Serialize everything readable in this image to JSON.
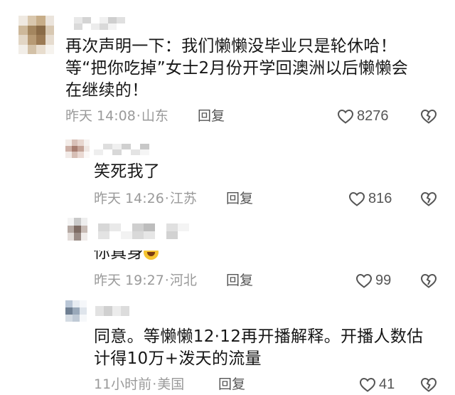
{
  "comments": [
    {
      "text_lines": [
        "再次声明一下：我们懒懒没毕业只是轮休哈！",
        "等“把你吃掉”女士2月份开学回澳洲以后懒懒会",
        "在继续的！"
      ],
      "time": "昨天 14:08",
      "location": "山东",
      "reply_label": "回复",
      "likes": "8276"
    },
    {
      "text_lines": [
        "笑死我了"
      ],
      "time": "昨天 14:26",
      "location": "江苏",
      "reply_label": "回复",
      "likes": "816"
    },
    {
      "text_lines": [
        "你真身"
      ],
      "time": "昨天 19:27",
      "location": "河北",
      "reply_label": "回复",
      "likes": "99"
    },
    {
      "text_lines": [
        "同意。等懒懒12·12再开播解释。开播人数估",
        "计得10万+泼天的流量"
      ],
      "time": "11小时前",
      "location": "美国",
      "reply_label": "回复",
      "likes": "41"
    }
  ],
  "icons": {
    "like": "heart-outline-icon",
    "dislike": "broken-heart-icon"
  },
  "colors": {
    "text": "#161616",
    "meta": "#9a9a9a",
    "icon": "#555555"
  }
}
